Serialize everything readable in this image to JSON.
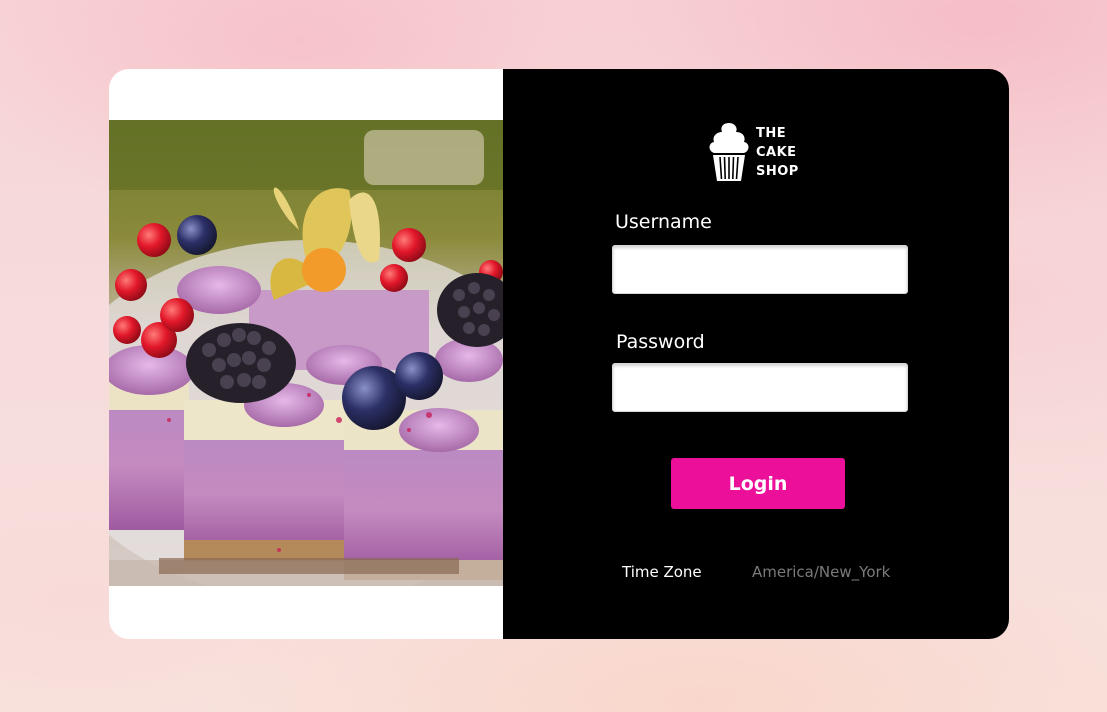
{
  "brand": {
    "logo_lines": [
      "THE",
      "CAKE",
      "SHOP"
    ],
    "logo_icon": "cupcake-icon"
  },
  "form": {
    "username_label": "Username",
    "username_value": "",
    "username_placeholder": "",
    "password_label": "Password",
    "password_value": "",
    "password_placeholder": "",
    "login_label": "Login"
  },
  "footer": {
    "timezone_label": "Time Zone",
    "timezone_value": "America/New_York"
  },
  "colors": {
    "accent": "#ec0f9a",
    "panel_bg": "#000000",
    "muted_text": "#7a7a7a"
  },
  "hero_image": "cake-slices-with-berries-photo"
}
